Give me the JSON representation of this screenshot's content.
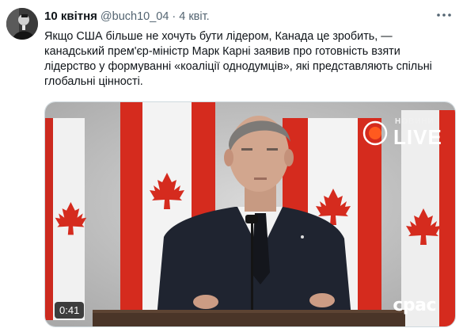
{
  "tweet": {
    "display_name": "10 квітня",
    "handle": "@buch10_04",
    "separator": "·",
    "time": "4 квіт.",
    "text": "Якщо США більше не хочуть бути лідером, Канада це зробить, —\nканадський прем'єр-міністр Марк Карні заявив про готовність взяти\nлідерство у формуванні «коаліції однодумців», які представляють спільні\nглобальні цінності.",
    "more_icon": "more-dots-icon"
  },
  "video": {
    "duration": "0:41",
    "live_news_label": "НОВИНИ",
    "live_label": "LIVE",
    "brand_watermark": "cpac",
    "colors": {
      "flag_red": "#d52b1e",
      "flag_white": "#f4f4f4",
      "background": "#c9c9c9",
      "suit": "#1f2430",
      "podium": "#4a3528"
    }
  }
}
